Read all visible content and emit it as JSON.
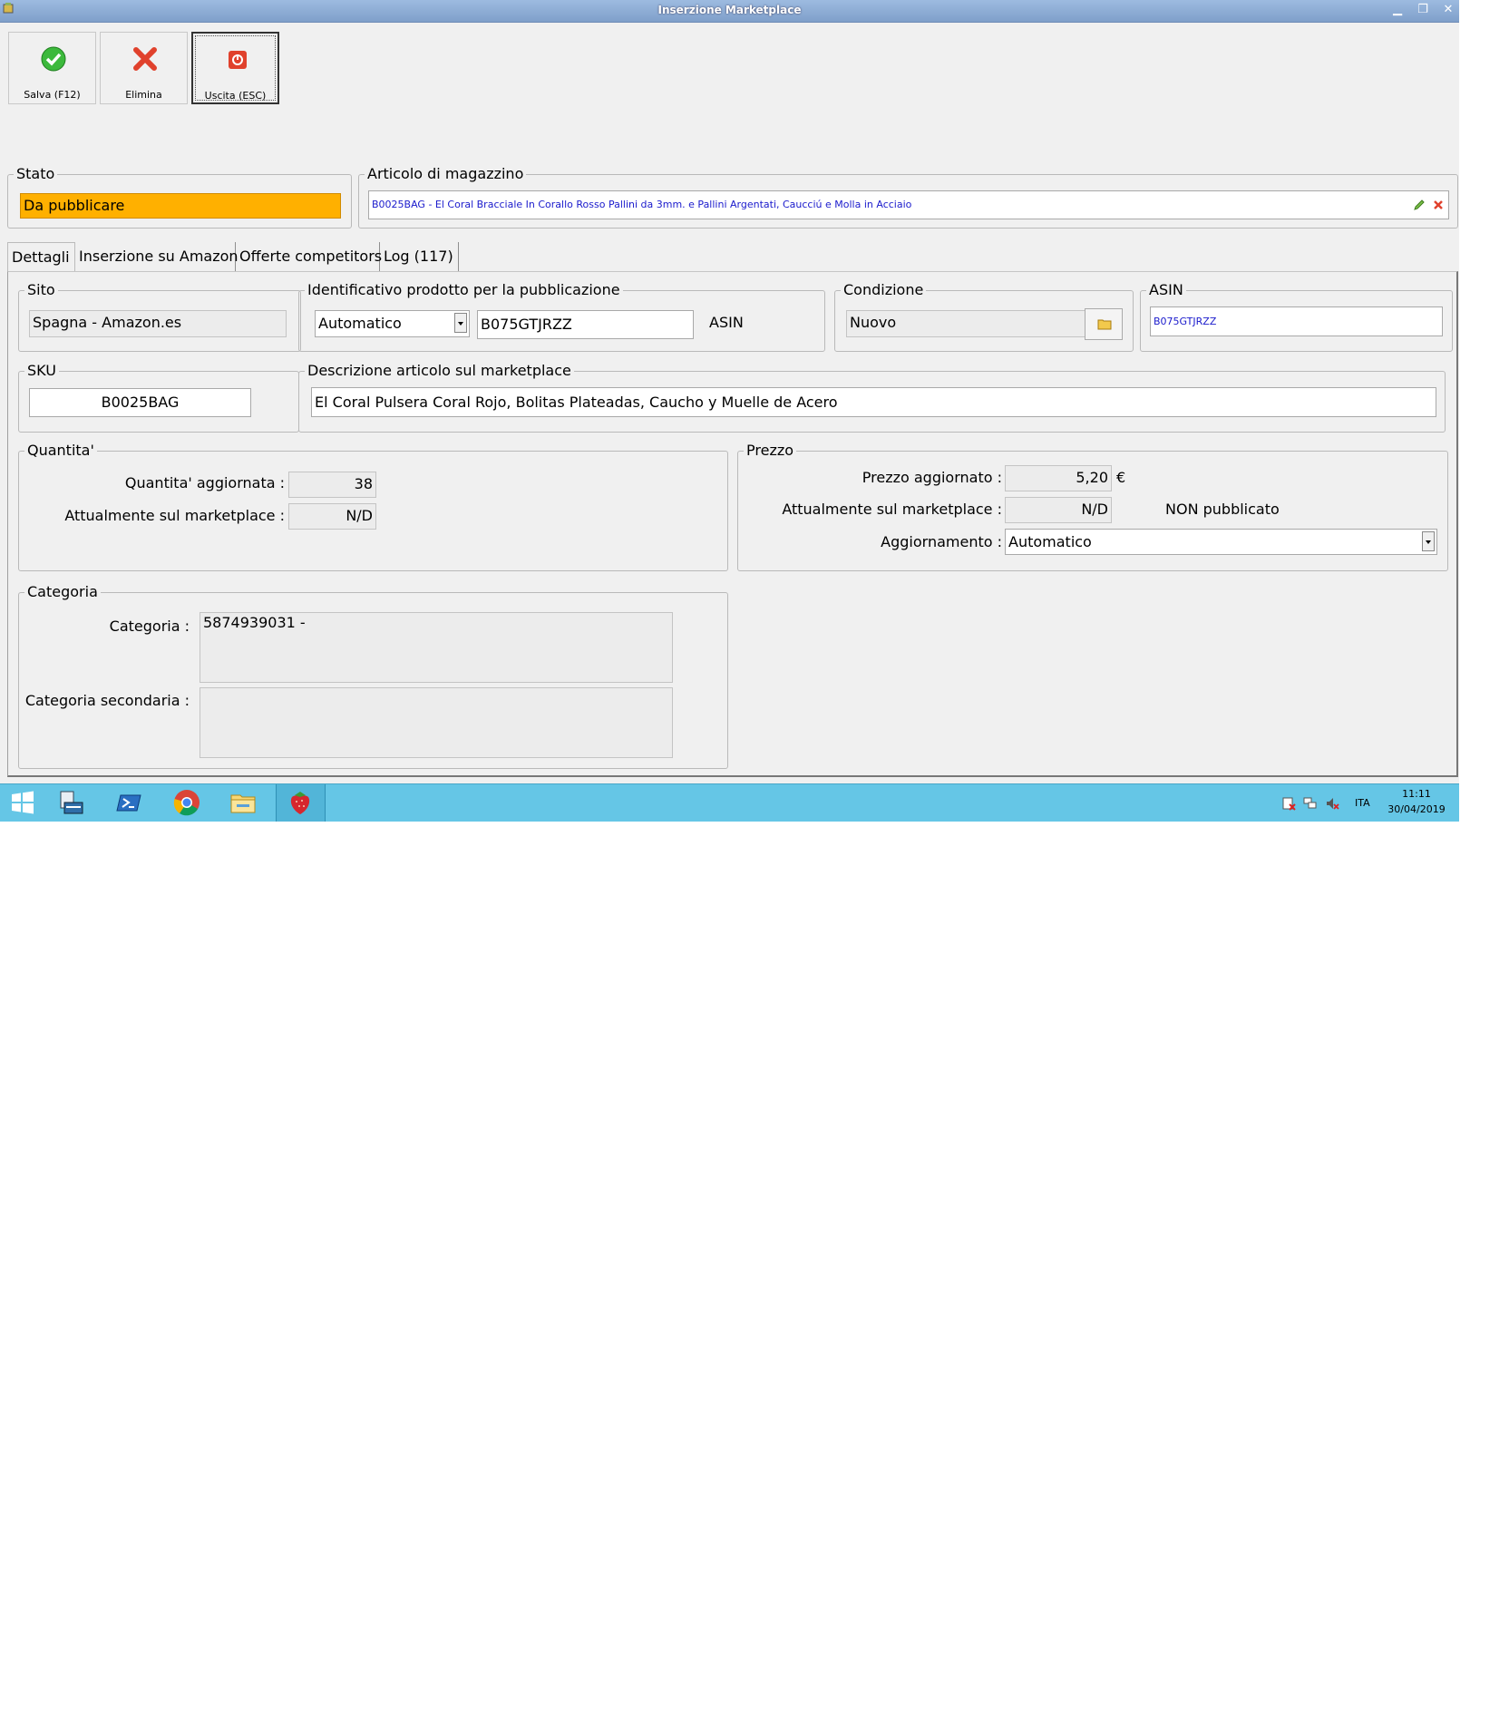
{
  "window": {
    "title": "Inserzione Marketplace"
  },
  "toolbar": {
    "save_label": "Salva (F12)",
    "delete_label": "Elimina",
    "exit_label": "Uscita (ESC)"
  },
  "stato": {
    "legend": "Stato",
    "value": "Da pubblicare"
  },
  "articolo": {
    "legend": "Articolo di magazzino",
    "value": "B0025BAG - El Coral Bracciale In Corallo Rosso Pallini da 3mm. e Pallini Argentati, Caucciú e Molla in Acciaio"
  },
  "tabs": [
    {
      "label": "Dettagli"
    },
    {
      "label": "Inserzione su Amazon"
    },
    {
      "label": "Offerte competitors"
    },
    {
      "label": "Log (117)"
    }
  ],
  "sito": {
    "legend": "Sito",
    "value": "Spagna - Amazon.es"
  },
  "identificativo": {
    "legend": "Identificativo prodotto per la pubblicazione",
    "mode": "Automatico",
    "code": "B075GTJRZZ",
    "type_label": "ASIN"
  },
  "condizione": {
    "legend": "Condizione",
    "value": "Nuovo"
  },
  "asin": {
    "legend": "ASIN",
    "value": "B075GTJRZZ"
  },
  "sku": {
    "legend": "SKU",
    "value": "B0025BAG"
  },
  "descrizione": {
    "legend": "Descrizione articolo sul marketplace",
    "value": "El Coral Pulsera Coral Rojo, Bolitas Plateadas, Caucho y Muelle de Acero"
  },
  "quantita": {
    "legend": "Quantita'",
    "updated_label": "Quantita' aggiornata :",
    "updated_value": "38",
    "current_label": "Attualmente sul marketplace :",
    "current_value": "N/D"
  },
  "prezzo": {
    "legend": "Prezzo",
    "updated_label": "Prezzo aggiornato :",
    "updated_value": "5,20",
    "currency": "€",
    "current_label": "Attualmente sul marketplace :",
    "current_value": "N/D",
    "status": "NON pubblicato",
    "update_label": "Aggiornamento :",
    "update_value": "Automatico"
  },
  "categoria": {
    "legend": "Categoria",
    "primary_label": "Categoria :",
    "primary_value": "5874939031 -",
    "secondary_label": "Categoria secondaria :",
    "secondary_value": ""
  },
  "taskbar": {
    "language": "ITA",
    "time": "11:11",
    "date": "30/04/2019"
  },
  "colors": {
    "stato_bg": "#ffb000",
    "taskbar": "#65c6e6",
    "link_blue": "#1a1acc"
  }
}
